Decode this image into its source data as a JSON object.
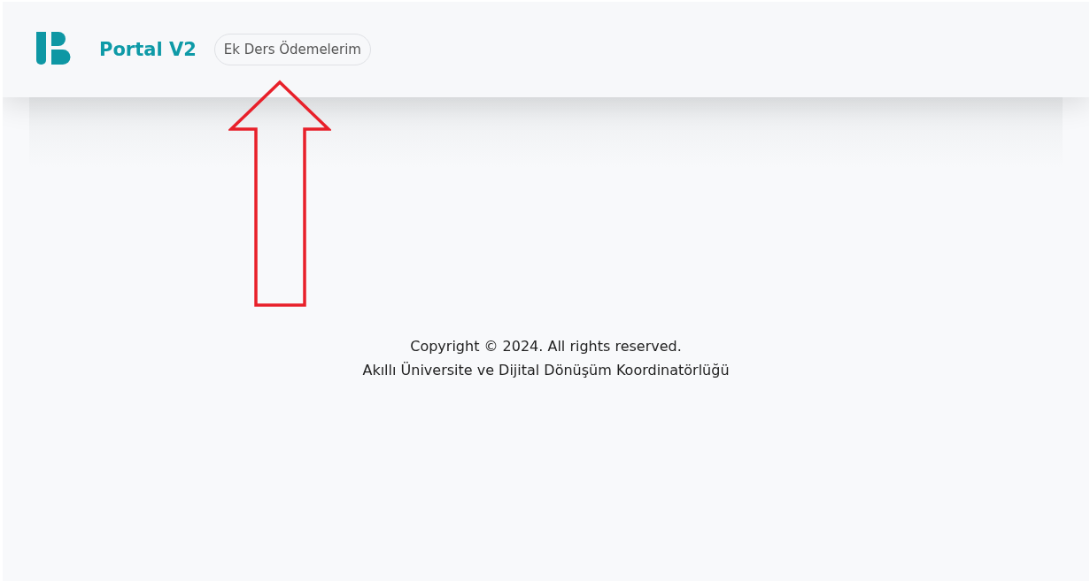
{
  "header": {
    "brand": "Portal V2",
    "nav_items": [
      {
        "label": "Ek Ders Ödemelerim",
        "selected": false
      }
    ]
  },
  "footer": {
    "lines": [
      "Copyright © 2024. All rights reserved.",
      "Akıllı Üniversite ve Dijital Dönüşüm Koordinatörlüğü"
    ]
  }
}
